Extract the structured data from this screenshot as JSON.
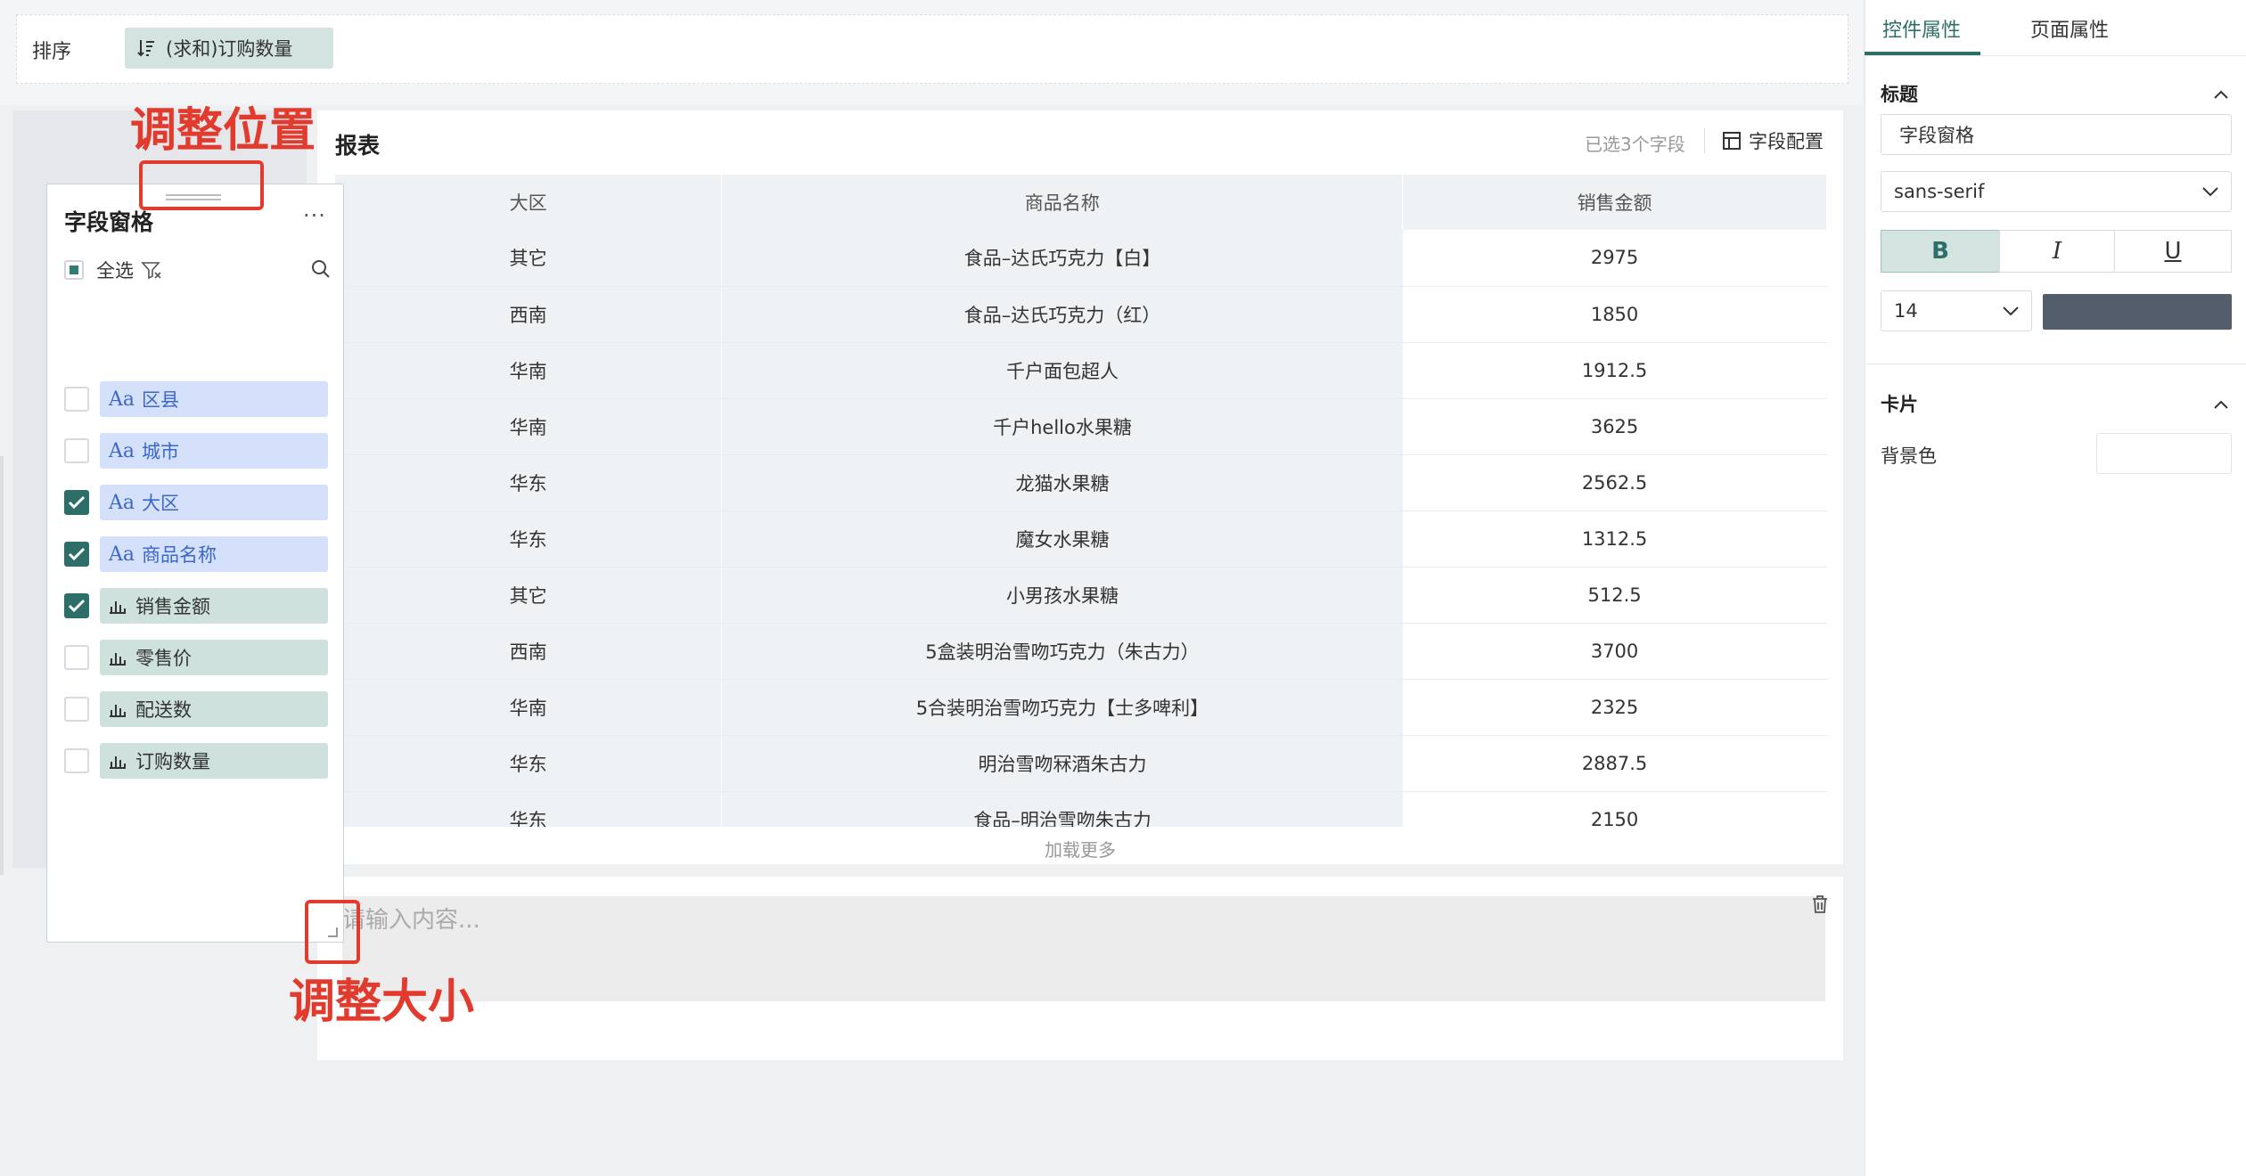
{
  "sort_bar": {
    "label": "排序",
    "chip": "(求和)订购数量"
  },
  "report": {
    "title": "报表",
    "selected_info": "已选3个字段",
    "config_label": "字段配置",
    "columns": [
      "大区",
      "商品名称",
      "销售金额"
    ],
    "rows": [
      [
        "其它",
        "食品–达氏巧克力【白】",
        "2975"
      ],
      [
        "西南",
        "食品–达氏巧克力（红）",
        "1850"
      ],
      [
        "华南",
        "千户面包超人",
        "1912.5"
      ],
      [
        "华南",
        "千户hello水果糖",
        "3625"
      ],
      [
        "华东",
        "龙猫水果糖",
        "2562.5"
      ],
      [
        "华东",
        "魔女水果糖",
        "1312.5"
      ],
      [
        "其它",
        "小男孩水果糖",
        "512.5"
      ],
      [
        "西南",
        "5盒装明治雪吻巧克力（朱古力）",
        "3700"
      ],
      [
        "华南",
        "5合装明治雪吻巧克力【士多啤利】",
        "2325"
      ],
      [
        "华东",
        "明治雪吻冧酒朱古力",
        "2887.5"
      ],
      [
        "华东",
        "食品–明治雪吻朱古力",
        "2150"
      ]
    ],
    "load_more": "加载更多"
  },
  "text_widget": {
    "placeholder": "请输入内容..."
  },
  "field_panel": {
    "title": "字段窗格",
    "more": "···",
    "select_all": "全选",
    "fields": [
      {
        "name": "区县",
        "kind": "dimension",
        "checked": false
      },
      {
        "name": "城市",
        "kind": "dimension",
        "checked": false
      },
      {
        "name": "大区",
        "kind": "dimension",
        "checked": true
      },
      {
        "name": "商品名称",
        "kind": "dimension",
        "checked": true
      },
      {
        "name": "销售金额",
        "kind": "measure",
        "checked": true
      },
      {
        "name": "零售价",
        "kind": "measure",
        "checked": false
      },
      {
        "name": "配送数",
        "kind": "measure",
        "checked": false
      },
      {
        "name": "订购数量",
        "kind": "measure",
        "checked": false
      }
    ],
    "dim_icon": "Aa"
  },
  "annotations": {
    "move": "调整位置",
    "resize": "调整大小"
  },
  "properties": {
    "tabs": [
      "控件属性",
      "页面属性"
    ],
    "title_section": "标题",
    "title_value": "字段窗格",
    "font": "sans-serif",
    "bold": "B",
    "italic": "I",
    "underline": "U",
    "font_size": "14",
    "font_color": "#545d6b",
    "card_section": "卡片",
    "background_label": "背景色"
  }
}
